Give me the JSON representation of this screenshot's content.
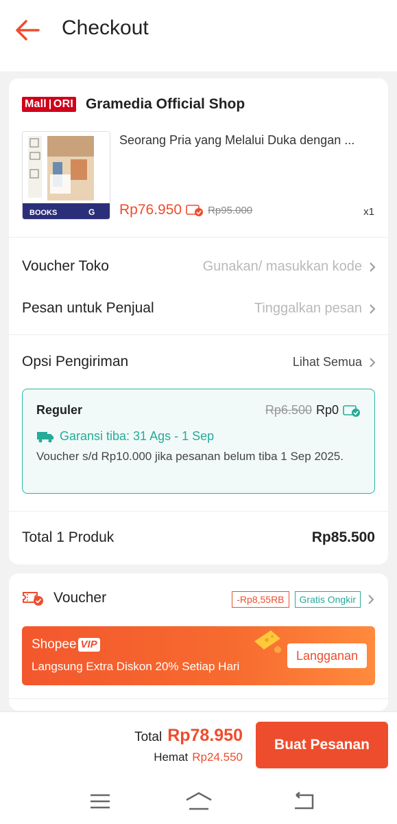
{
  "header": {
    "title": "Checkout"
  },
  "shop": {
    "badge_left": "Mall",
    "badge_right": "ORI",
    "name": "Gramedia Official Shop"
  },
  "product": {
    "name": "Seorang Pria yang Melalui Duka dengan ...",
    "price": "Rp76.950",
    "original_price": "Rp95.000",
    "quantity": "x1",
    "image_label_left": "BOOKS",
    "image_label_right": "G"
  },
  "voucher_toko": {
    "label": "Voucher Toko",
    "placeholder": "Gunakan/ masukkan kode"
  },
  "message": {
    "label": "Pesan untuk Penjual",
    "placeholder": "Tinggalkan pesan"
  },
  "shipping": {
    "label": "Opsi Pengiriman",
    "see_all": "Lihat Semua",
    "option_name": "Reguler",
    "old_price": "Rp6.500",
    "new_price": "Rp0",
    "guarantee": "Garansi tiba: 31 Ags - 1 Sep",
    "note": "Voucher s/d  Rp10.000 jika pesanan belum tiba 1 Sep 2025."
  },
  "subtotal": {
    "label": "Total 1 Produk",
    "value": "Rp85.500"
  },
  "voucher": {
    "label": "Voucher",
    "discount_tag": "-Rp8,55RB",
    "shipping_tag": "Gratis Ongkir"
  },
  "vip_banner": {
    "brand": "Shopee",
    "badge": "VIP",
    "text": "Langsung Extra Diskon 20% Setiap Hari",
    "button": "Langganan"
  },
  "bottom_bar": {
    "total_label": "Total",
    "total_value": "Rp78.950",
    "save_label": "Hemat",
    "save_value": "Rp24.550",
    "order_button": "Buat Pesanan"
  },
  "colors": {
    "accent": "#ee4d2d",
    "teal": "#26aa99",
    "mall_red": "#d0011b"
  },
  "icons": {
    "back": "arrow-left-icon",
    "chevron": "chevron-right-icon",
    "truck": "truck-icon",
    "voucher": "voucher-icon",
    "nav": [
      "menu-icon",
      "home-icon",
      "back-nav-icon"
    ]
  }
}
